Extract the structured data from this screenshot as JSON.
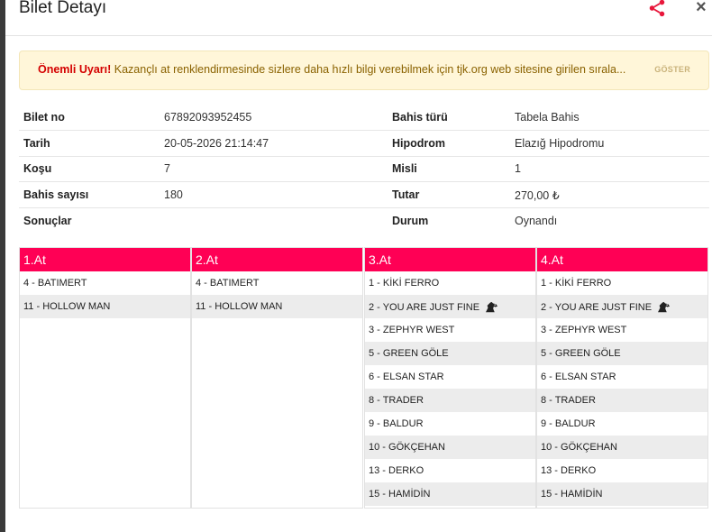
{
  "modal": {
    "title": "Bilet Detayı",
    "share_icon": "share-icon",
    "close_icon": "close-icon",
    "close_glyph": "×"
  },
  "alert": {
    "strong": "Önemli Uyarı!",
    "text": " Kazançlı at renklendirmesinde sizlere daha hızlı bilgi verebilmek için tjk.org web sitesine girilen sırala...",
    "button": "GÖSTER",
    "colors": {
      "background": "#fff6d9",
      "strong": "#d40000",
      "text": "#8a6200"
    }
  },
  "info": {
    "rows": [
      {
        "l1": "Bilet no",
        "v1": "67892093952455",
        "l2": "Bahis türü",
        "v2": "Tabela Bahis"
      },
      {
        "l1": "Tarih",
        "v1": "20-05-2026 21:14:47",
        "l2": "Hipodrom",
        "v2": "Elazığ Hipodromu"
      },
      {
        "l1": "Koşu",
        "v1": "7",
        "l2": "Misli",
        "v2": "1"
      },
      {
        "l1": "Bahis sayısı",
        "v1": "180",
        "l2": "Tutar",
        "v2": "270,00 ₺"
      },
      {
        "l1": "Sonuçlar",
        "v1": "",
        "l2": "Durum",
        "v2": "Oynandı"
      }
    ]
  },
  "horses": {
    "accent_color": "#ff0055",
    "columns": [
      {
        "header": "1.At",
        "items": [
          "4 - BATIMERT",
          "11 - HOLLOW MAN"
        ]
      },
      {
        "header": "2.At",
        "items": [
          "4 - BATIMERT",
          "11 - HOLLOW MAN"
        ]
      },
      {
        "header": "3.At",
        "items": [
          "1 - KİKİ FERRO",
          "2 - YOU ARE JUST FINE",
          "3 - ZEPHYR WEST",
          "5 - GREEN GÖLE",
          "6 - ELSAN STAR",
          "8 - TRADER",
          "9 - BALDUR",
          "10 - GÖKÇEHAN",
          "13 - DERKO",
          "15 - HAMİDİN"
        ]
      },
      {
        "header": "4.At",
        "items": [
          "1 - KİKİ FERRO",
          "2 - YOU ARE JUST FINE",
          "3 - ZEPHYR WEST",
          "5 - GREEN GÖLE",
          "6 - ELSAN STAR",
          "8 - TRADER",
          "9 - BALDUR",
          "10 - GÖKÇEHAN",
          "13 - DERKO",
          "15 - HAMİDİN"
        ]
      }
    ],
    "horse_icon_item": "2 - YOU ARE JUST FINE",
    "horse_icon": "horse-head-icon"
  }
}
